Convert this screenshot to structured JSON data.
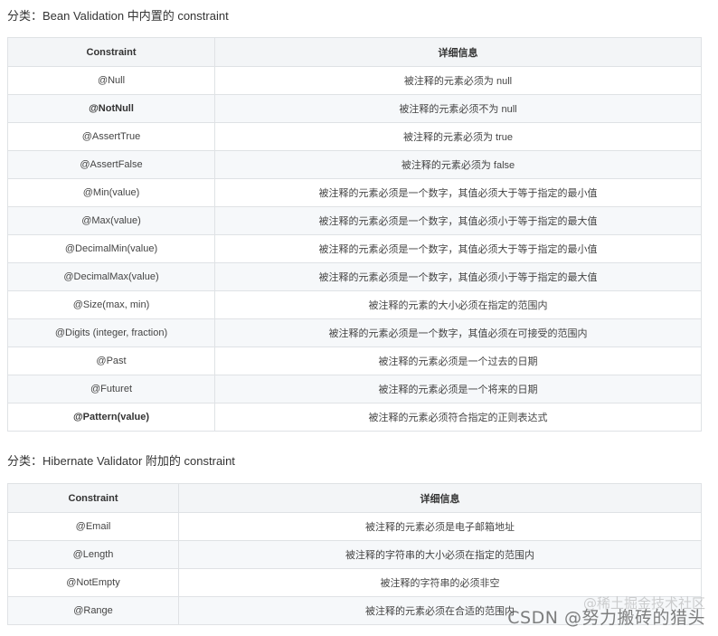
{
  "section1": {
    "title": "分类：Bean Validation 中内置的 constraint",
    "headers": [
      "Constraint",
      "详细信息"
    ],
    "rows": [
      {
        "constraint": "@Null",
        "detail": "被注释的元素必须为 null",
        "bold": false
      },
      {
        "constraint": "@NotNull",
        "detail": "被注释的元素必须不为 null",
        "bold": true
      },
      {
        "constraint": "@AssertTrue",
        "detail": "被注释的元素必须为 true",
        "bold": false
      },
      {
        "constraint": "@AssertFalse",
        "detail": "被注释的元素必须为 false",
        "bold": false
      },
      {
        "constraint": "@Min(value)",
        "detail": "被注释的元素必须是一个数字，其值必须大于等于指定的最小值",
        "bold": false
      },
      {
        "constraint": "@Max(value)",
        "detail": "被注释的元素必须是一个数字，其值必须小于等于指定的最大值",
        "bold": false
      },
      {
        "constraint": "@DecimalMin(value)",
        "detail": "被注释的元素必须是一个数字，其值必须大于等于指定的最小值",
        "bold": false
      },
      {
        "constraint": "@DecimalMax(value)",
        "detail": "被注释的元素必须是一个数字，其值必须小于等于指定的最大值",
        "bold": false
      },
      {
        "constraint": "@Size(max, min)",
        "detail": "被注释的元素的大小必须在指定的范围内",
        "bold": false
      },
      {
        "constraint": "@Digits (integer, fraction)",
        "detail": "被注释的元素必须是一个数字，其值必须在可接受的范围内",
        "bold": false
      },
      {
        "constraint": "@Past",
        "detail": "被注释的元素必须是一个过去的日期",
        "bold": false
      },
      {
        "constraint": "@Futuret",
        "detail": "被注释的元素必须是一个将来的日期",
        "bold": false
      },
      {
        "constraint": "@Pattern(value)",
        "detail": "被注释的元素必须符合指定的正则表达式",
        "bold": true
      }
    ]
  },
  "section2": {
    "title": "分类：Hibernate Validator 附加的 constraint",
    "headers": [
      "Constraint",
      "详细信息"
    ],
    "rows": [
      {
        "constraint": "@Email",
        "detail": "被注释的元素必须是电子邮箱地址",
        "bold": false
      },
      {
        "constraint": "@Length",
        "detail": "被注释的字符串的大小必须在指定的范围内",
        "bold": false
      },
      {
        "constraint": "@NotEmpty",
        "detail": "被注释的字符串的必须非空",
        "bold": false
      },
      {
        "constraint": "@Range",
        "detail": "被注释的元素必须在合适的范围内",
        "bold": false
      }
    ]
  },
  "watermark": {
    "text": "CSDN @努力搬砖的猎头",
    "back_text": "@稀土掘金技术社区"
  }
}
